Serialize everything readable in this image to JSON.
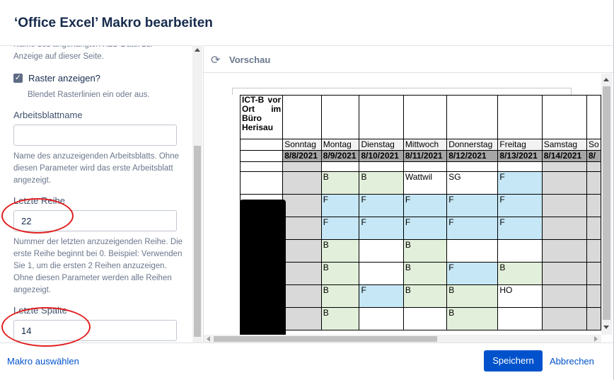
{
  "dialog": {
    "title": "‘Office Excel’ Makro bearbeiten"
  },
  "sidebar": {
    "top_help": "Name des angehängten XLS-Datei zur Anzeige auf dieser Seite.",
    "raster": {
      "label": "Raster anzeigen?",
      "checked": true,
      "help": "Blendet Rasterlinien ein oder aus."
    },
    "sheetname": {
      "label": "Arbeitsblattname",
      "value": "",
      "help": "Name des anzuzeigenden Arbeitsblatts. Ohne diesen Parameter wird das erste Arbeitsblatt angezeigt."
    },
    "last_row": {
      "label": "Letzte Reihe",
      "value": "22",
      "help": "Nummer der letzten anzuzeigenden Reihe. Die erste Reihe beginnt bei 0. Beispiel: Verwenden Sie 1, um die ersten 2 Reihen anzuzeigen. Ohne diesen Parameter werden alle Reihen angezeigt."
    },
    "last_col": {
      "label": "Letzte Spalte",
      "value": "14"
    }
  },
  "preview": {
    "title": "Vorschau",
    "sheet": {
      "title_cell": "ICT-B vor Ort im Büro Herisau",
      "days": [
        "Sonntag",
        "Montag",
        "Dienstag",
        "Mittwoch",
        "Donnerstag",
        "Freitag",
        "Samstag",
        "So"
      ],
      "dates": [
        "8/8/2021",
        "8/9/2021",
        "8/10/2021",
        "8/11/2021",
        "8/12/2021",
        "8/13/2021",
        "8/14/2021",
        "8/"
      ],
      "rows": [
        [
          "",
          "B",
          "B",
          "Wattwil",
          "SG",
          "F",
          "",
          ""
        ],
        [
          "",
          "F",
          "F",
          "F",
          "F",
          "F",
          "",
          ""
        ],
        [
          "",
          "F",
          "F",
          "F",
          "F",
          "F",
          "",
          ""
        ],
        [
          "",
          "B",
          "",
          "B",
          "",
          "",
          "",
          ""
        ],
        [
          "",
          "B",
          "",
          "B",
          "F",
          "B",
          "",
          ""
        ],
        [
          "",
          "B",
          "F",
          "B",
          "B",
          "HO",
          "",
          ""
        ],
        [
          "",
          "B",
          "",
          "",
          "B",
          "",
          "",
          ""
        ]
      ]
    }
  },
  "footer": {
    "select_macro": "Makro auswählen",
    "save": "Speichern",
    "cancel": "Abbrechen"
  },
  "colors": {
    "accent": "#0052cc",
    "annotation": "#e02020",
    "cell_green": "#e2efda",
    "cell_blue": "#c6e7f5",
    "cell_gray": "#d9d9d9"
  }
}
